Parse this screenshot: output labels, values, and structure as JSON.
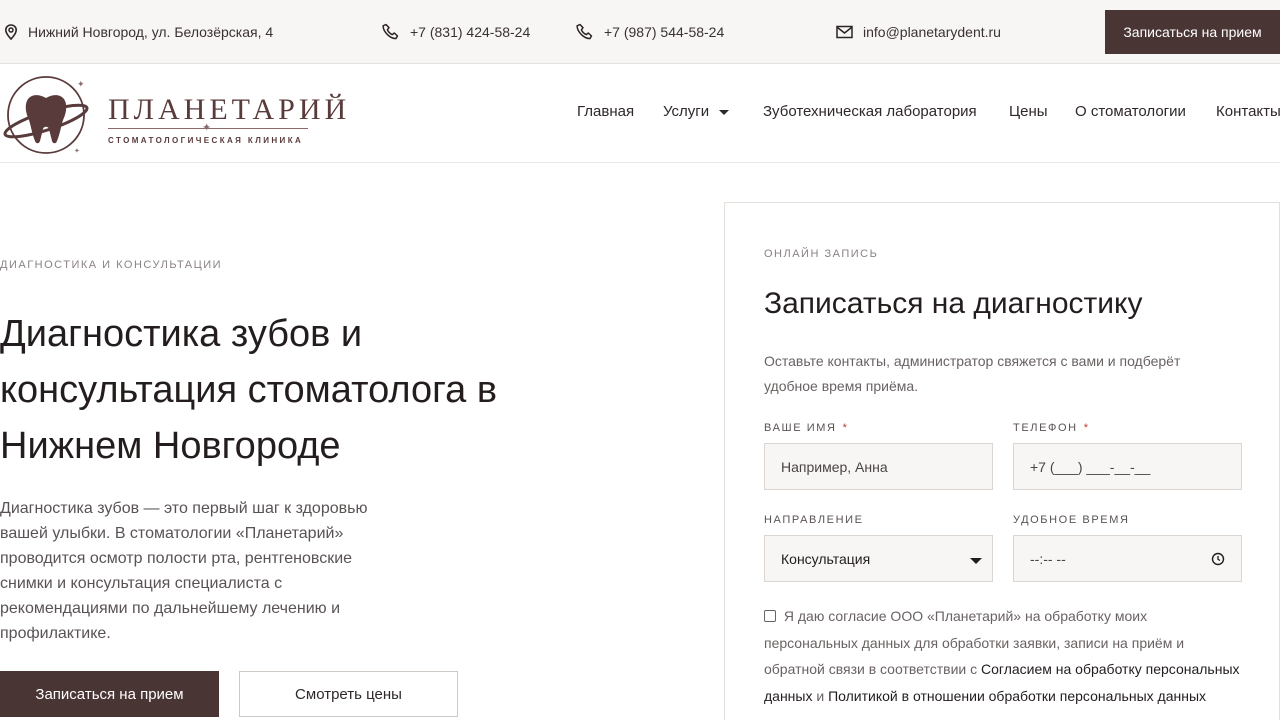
{
  "topbar": {
    "address": "Нижний Новгород, ул. Белозёрская, 4",
    "phone1": "+7 (831) 424-58-24",
    "phone2": "+7 (987) 544-58-24",
    "email": "info@planetarydent.ru",
    "cta": "Записаться на прием"
  },
  "logo": {
    "title": "ПЛАНЕТАРИЙ",
    "subtitle": "СТОМАТОЛОГИЧЕСКАЯ КЛИНИКА"
  },
  "nav": {
    "items": [
      "Главная",
      "Услуги",
      "Зуботехническая лаборатория",
      "Цены",
      "О стоматологии",
      "Контакты"
    ]
  },
  "hero": {
    "eyebrow": "ДИАГНОСТИКА И КОНСУЛЬТАЦИИ",
    "title": "Диагностика зубов и консультация стоматолога в Нижнем Новгороде",
    "text": "Диагностика зубов — это первый шаг к здоровью вашей улыбки. В стоматологии «Планетарий» проводится осмотр полости рта, рентгеновские снимки и консультация специалиста с рекомендациями по дальнейшему лечению и профилактике.",
    "primary_button": "Записаться на прием",
    "secondary_button": "Смотреть цены"
  },
  "form": {
    "eyebrow": "ОНЛАЙН ЗАПИСЬ",
    "title": "Записаться на диагностику",
    "description": "Оставьте контакты, администратор свяжется с вами и подберёт удобное время приёма.",
    "name_label": "ВАШЕ ИМЯ",
    "name_placeholder": "Например, Анна",
    "phone_label": "ТЕЛЕФОН",
    "phone_placeholder": "+7 (___) ___-__-__",
    "required_mark": "*",
    "direction_label": "НАПРАВЛЕНИЕ",
    "direction_value": "Консультация",
    "time_label": "УДОБНОЕ ВРЕМЯ",
    "time_value": "--:-- --",
    "consent_text": "Я даю согласие ООО «Планетарий» на обработку моих персональных данных для обработки заявки, записи на приём и обратной связи в соответствии с",
    "consent_link1": "Согласием на обработку персональных данных",
    "consent_and": "и",
    "consent_link2": "Политикой в отношении обработки персональных данных"
  },
  "colors": {
    "brand": "#4a3535",
    "logo": "#5a3b3b",
    "required": "#c0392b"
  },
  "icons": [
    "location-pin-icon",
    "phone-icon",
    "mail-icon",
    "tooth-logo-icon",
    "chevron-down-icon",
    "clock-icon"
  ]
}
